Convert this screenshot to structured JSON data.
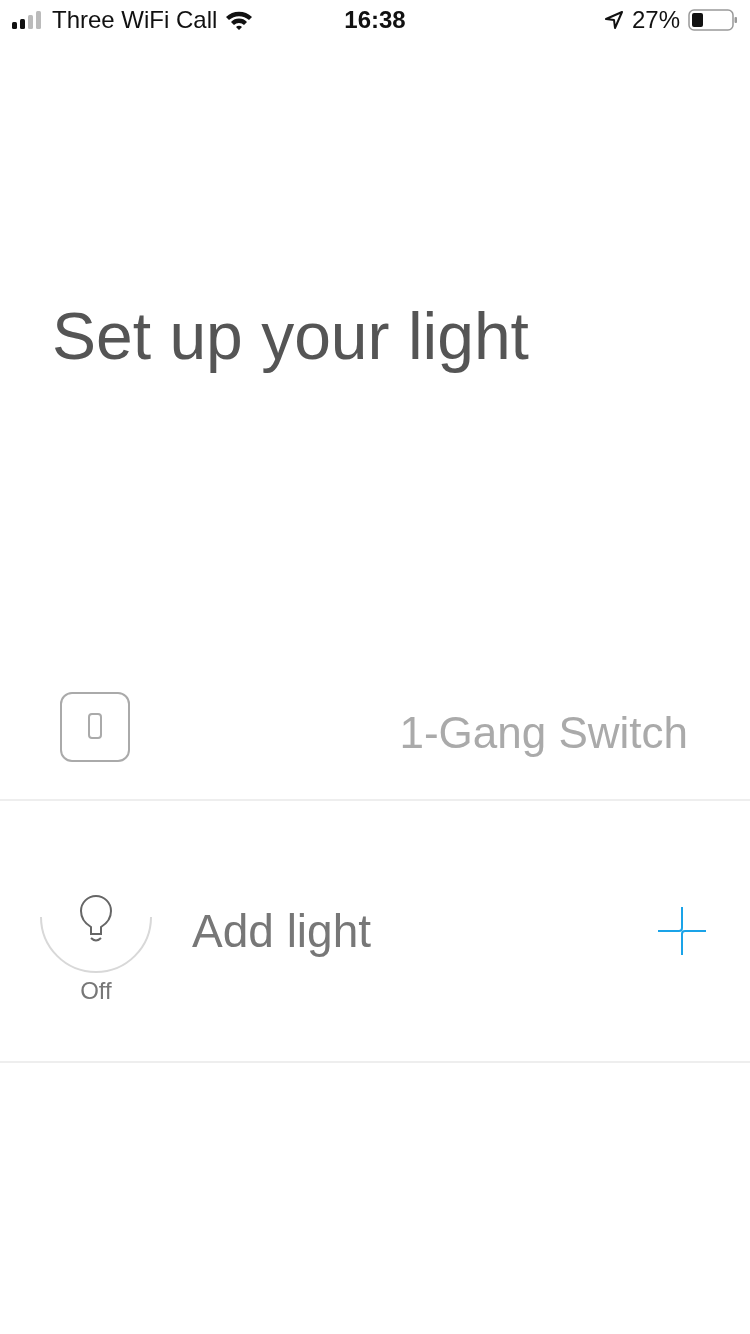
{
  "status_bar": {
    "carrier": "Three WiFi Call",
    "time": "16:38",
    "battery": "27%"
  },
  "title": "Set up your light",
  "device": {
    "name": "1-Gang Switch"
  },
  "light": {
    "label": "Add light",
    "status": "Off"
  }
}
